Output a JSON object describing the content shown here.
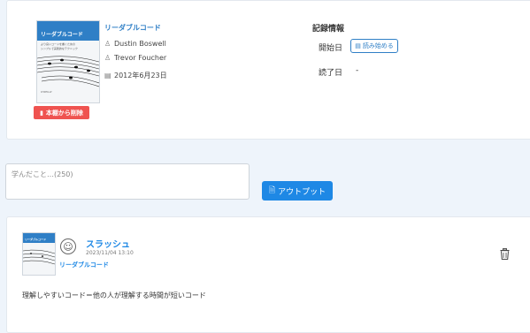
{
  "book": {
    "cover_title": "リーダブルコード",
    "cover_subtitle": "より良いコードを書くための",
    "cover_subtitle2": "シンプルで実践的なテクニック",
    "cover_bottom": "O'REILLY",
    "title": "リーダブルコード",
    "authors": [
      "Dustin Boswell",
      "Trevor Foucher"
    ],
    "published": "2012年6月23日",
    "remove_label": "本棚から削除"
  },
  "record": {
    "heading": "記録情報",
    "start_label": "開始日",
    "start_button": "読み始める",
    "end_label": "読了日",
    "end_value": "-"
  },
  "learn": {
    "placeholder": "学んだこと…(250)",
    "value": "",
    "output_button": "アウトプット"
  },
  "post": {
    "user": "スラッシュ",
    "time": "2023/11/04 13:10",
    "book": "リーダブルコード",
    "text": "理解しやすいコード＝他の人が理解する時間が短いコード"
  },
  "icons": {
    "user": "user-icon",
    "calendar": "calendar-icon",
    "trash": "trash-icon",
    "file": "file-icon",
    "smile": "smile-icon"
  },
  "colors": {
    "accent": "#1e88e5",
    "danger": "#ef5350",
    "background": "#eef4fb"
  }
}
